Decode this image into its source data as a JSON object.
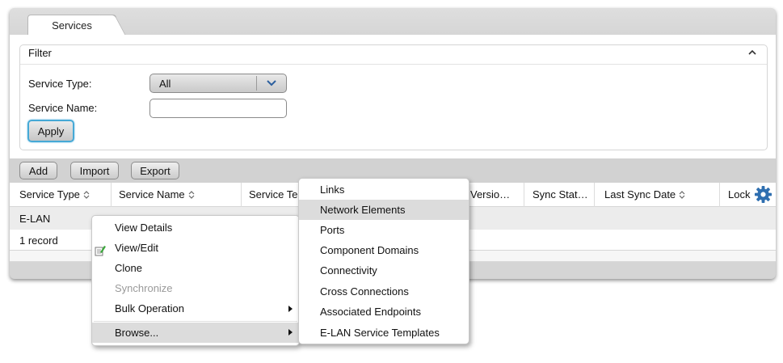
{
  "tabs": [
    {
      "label": "Services",
      "active": true
    }
  ],
  "filter": {
    "title": "Filter",
    "service_type_label": "Service Type:",
    "service_type_value": "All",
    "service_name_label": "Service Name:",
    "service_name_value": "",
    "apply_label": "Apply"
  },
  "toolbar": {
    "add_label": "Add",
    "import_label": "Import",
    "export_label": "Export"
  },
  "grid": {
    "columns": [
      "Service Type",
      "Service Name",
      "Service Te",
      "Versio…",
      "Sync Stat…",
      "Last Sync Date",
      "Lock"
    ],
    "rows": [
      [
        "E-LAN",
        "",
        "",
        "",
        "",
        "",
        ""
      ]
    ],
    "record_count": "1 record",
    "settings_icon": "gear-icon"
  },
  "context_menu": {
    "items": [
      {
        "label": "View Details",
        "enabled": true
      },
      {
        "label": "View/Edit",
        "enabled": true,
        "icon": "edit-icon"
      },
      {
        "label": "Clone",
        "enabled": true
      },
      {
        "label": "Synchronize",
        "enabled": false
      },
      {
        "label": "Bulk Operation",
        "enabled": true,
        "submenu": true
      },
      {
        "label": "Browse...",
        "enabled": true,
        "submenu": true,
        "highlighted": true
      }
    ]
  },
  "browse_submenu": {
    "items": [
      {
        "label": "Links"
      },
      {
        "label": "Network Elements",
        "highlighted": true
      },
      {
        "label": "Ports"
      },
      {
        "label": "Component Domains"
      },
      {
        "label": "Connectivity"
      },
      {
        "label": "Cross Connections"
      },
      {
        "label": "Associated Endpoints"
      },
      {
        "label": "E-LAN Service Templates"
      }
    ]
  },
  "colors": {
    "accent_focus": "#46a9d6",
    "gear": "#2f6fb0",
    "panel_bg": "#d5d5d5"
  }
}
